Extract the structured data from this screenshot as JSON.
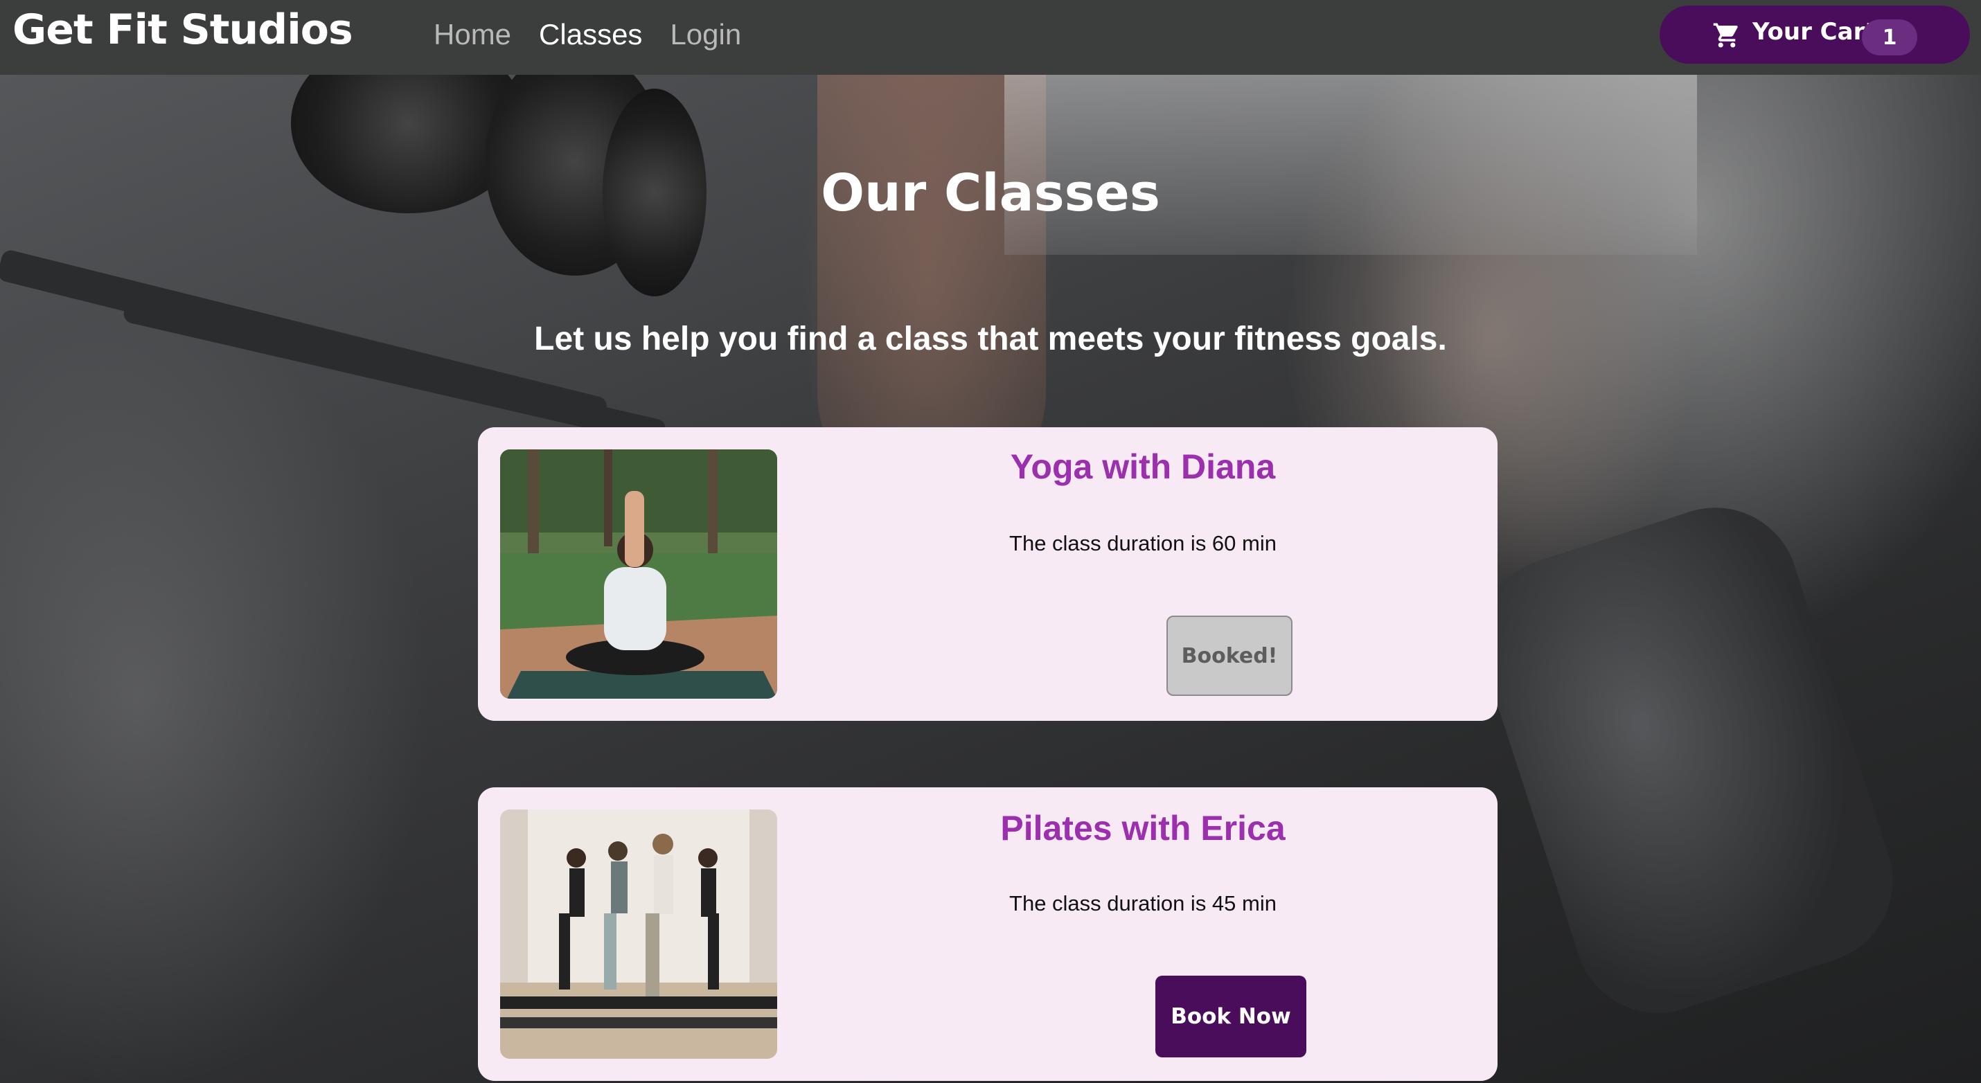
{
  "navbar": {
    "brand": "Get Fit Studios",
    "links": [
      {
        "label": "Home",
        "active": false
      },
      {
        "label": "Classes",
        "active": true
      },
      {
        "label": "Login",
        "active": false
      }
    ],
    "cart": {
      "label": "Your Cart",
      "count": "1",
      "icon": "cart-icon"
    }
  },
  "hero": {
    "title": "Our Classes",
    "subtitle": "Let us help you find a class that meets your fitness goals."
  },
  "classes": [
    {
      "title": "Yoga with Diana",
      "duration": "The class duration is 60 min",
      "button": "Booked!",
      "booked": true,
      "image": "yoga-photo"
    },
    {
      "title": "Pilates with Erica",
      "duration": "The class duration is 45 min",
      "button": "Book Now",
      "booked": false,
      "image": "pilates-photo"
    }
  ],
  "colors": {
    "navbar": "#3c3d3d",
    "accent": "#4a0d5c",
    "card_bg": "#f7eaf4",
    "card_title": "#9b2fae",
    "booked_button": "#c9c9c9"
  }
}
